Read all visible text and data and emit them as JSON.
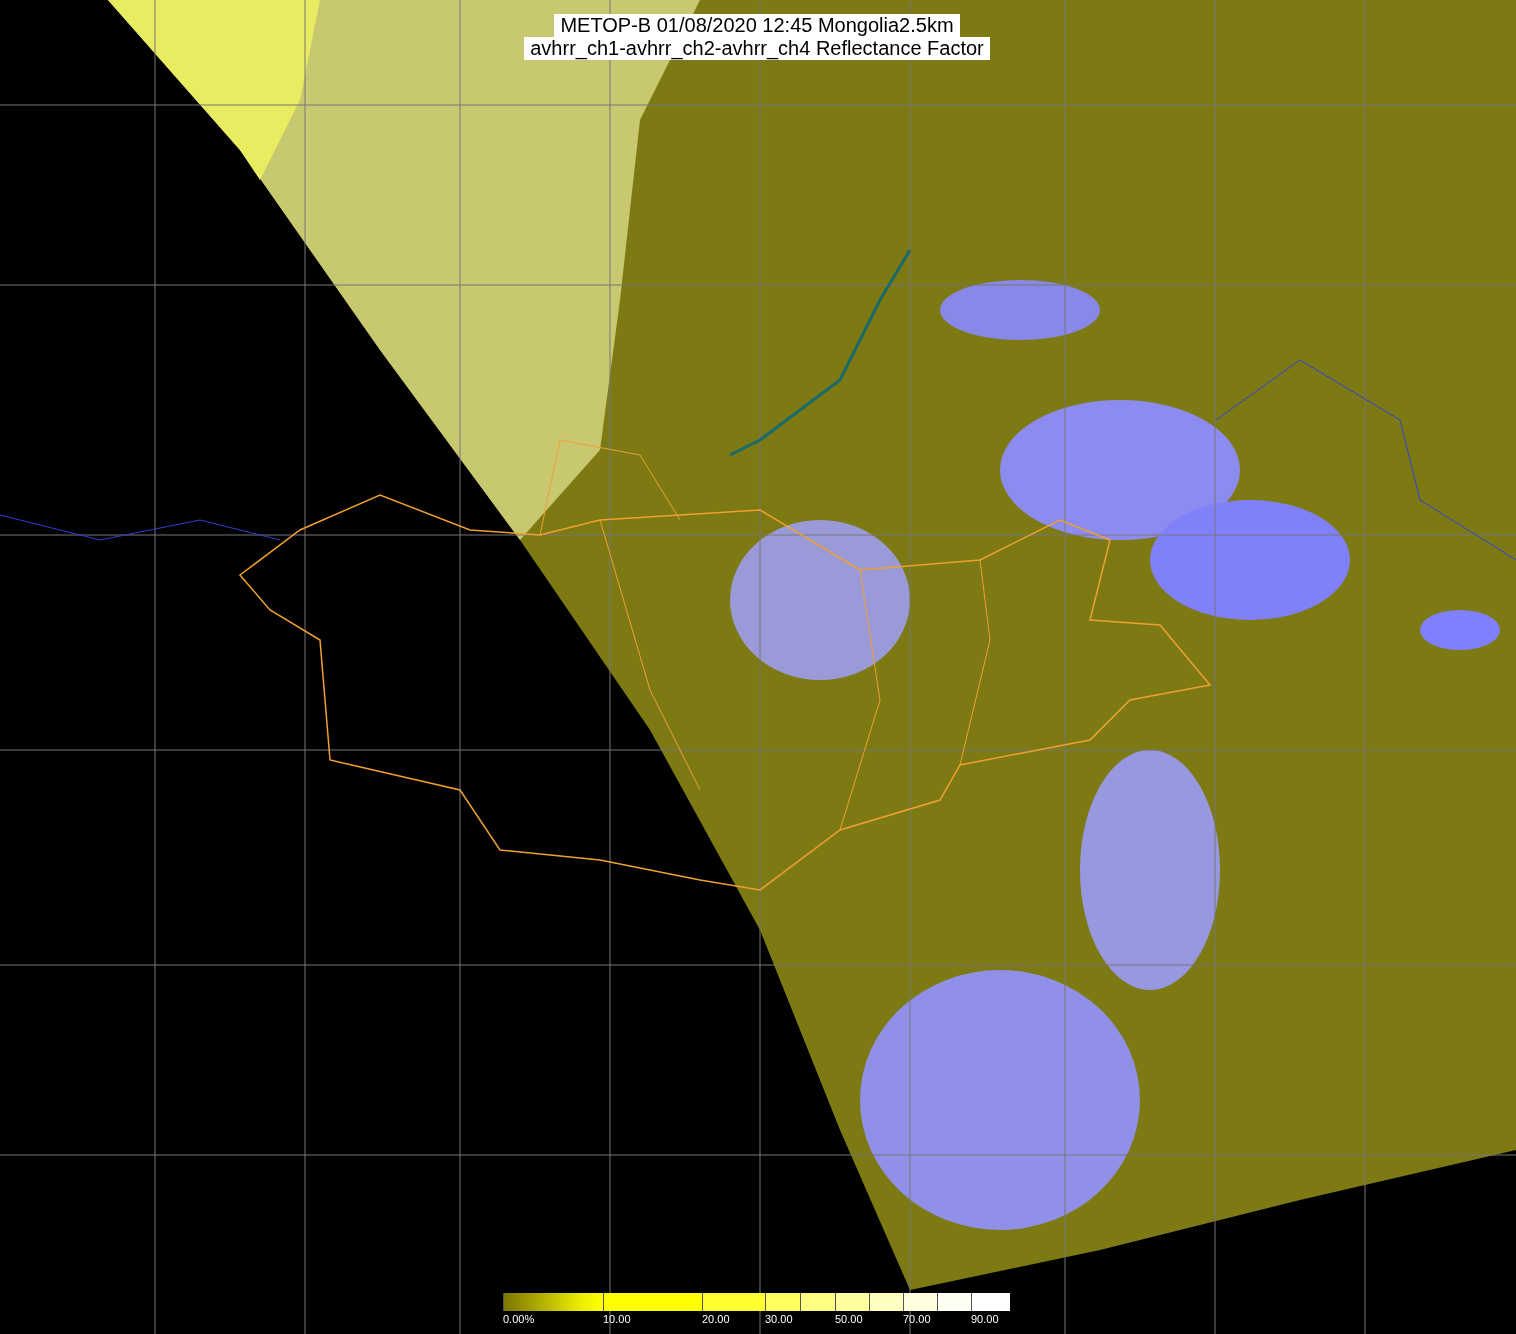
{
  "title": {
    "lines": [
      "METOP-B 01/08/2020 12:45 Mongolia2.5km",
      "avhrr_ch1-avhrr_ch2-avhrr_ch4 Reflectance Factor"
    ]
  },
  "color_scale": {
    "labels": [
      "0.00%",
      "10.00",
      "20.00",
      "30.00",
      "50.00",
      "70.00",
      "90.00"
    ]
  }
}
